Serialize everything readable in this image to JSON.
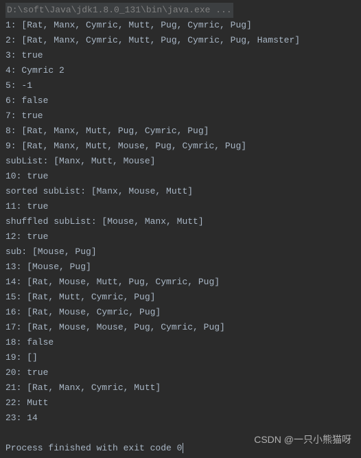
{
  "console": {
    "command": "D:\\soft\\Java\\jdk1.8.0_131\\bin\\java.exe ...",
    "lines": [
      "1: [Rat, Manx, Cymric, Mutt, Pug, Cymric, Pug]",
      "2: [Rat, Manx, Cymric, Mutt, Pug, Cymric, Pug, Hamster]",
      "3: true",
      "4: Cymric 2",
      "5: -1",
      "6: false",
      "7: true",
      "8: [Rat, Manx, Mutt, Pug, Cymric, Pug]",
      "9: [Rat, Manx, Mutt, Mouse, Pug, Cymric, Pug]",
      "subList: [Manx, Mutt, Mouse]",
      "10: true",
      "sorted subList: [Manx, Mouse, Mutt]",
      "11: true",
      "shuffled subList: [Mouse, Manx, Mutt]",
      "12: true",
      "sub: [Mouse, Pug]",
      "13: [Mouse, Pug]",
      "14: [Rat, Mouse, Mutt, Pug, Cymric, Pug]",
      "15: [Rat, Mutt, Cymric, Pug]",
      "16: [Rat, Mouse, Cymric, Pug]",
      "17: [Rat, Mouse, Mouse, Pug, Cymric, Pug]",
      "18: false",
      "19: []",
      "20: true",
      "21: [Rat, Manx, Cymric, Mutt]",
      "22: Mutt",
      "23: 14"
    ],
    "exit_message": "Process finished with exit code 0"
  },
  "watermark": "CSDN @一只小熊猫呀"
}
